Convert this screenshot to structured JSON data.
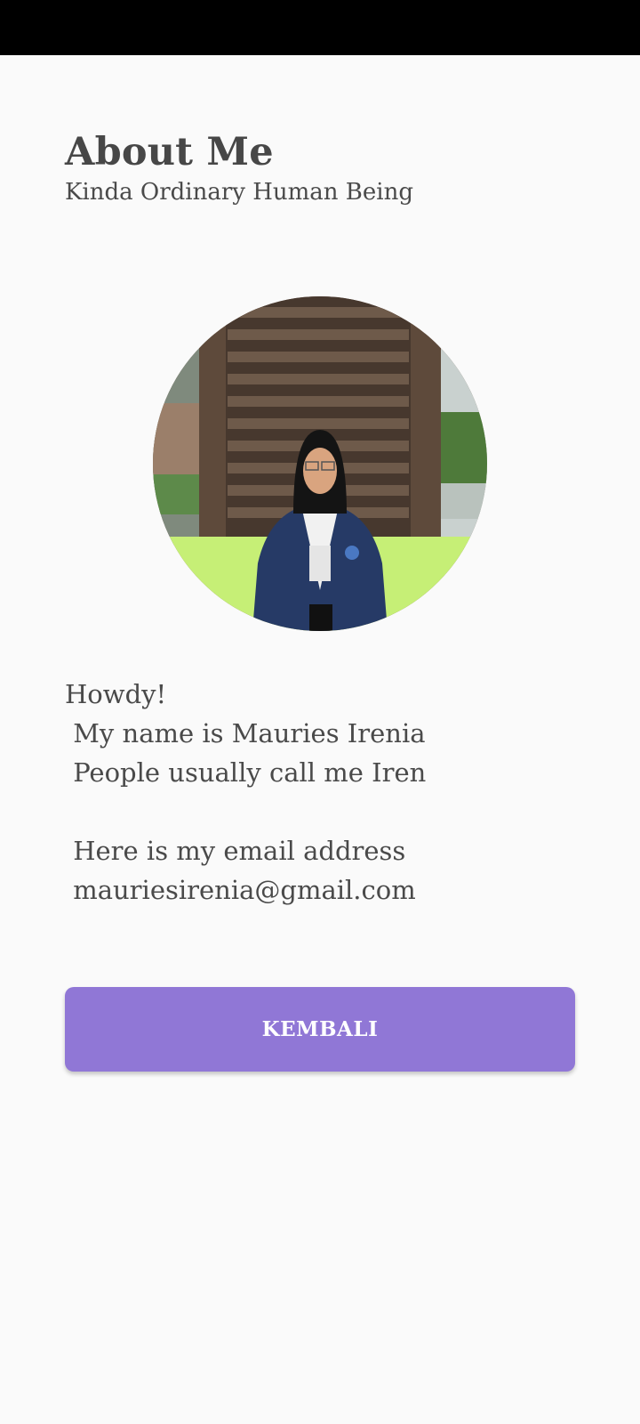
{
  "header": {
    "title": "About Me",
    "subtitle": "Kinda Ordinary Human Being"
  },
  "profile": {
    "photo_description": "profile-photo"
  },
  "bio": {
    "lines": [
      "Howdy!",
      " My name is Mauries Irenia",
      " People usually call me Iren",
      "",
      " Here is my email address",
      " mauriesirenia@gmail.com"
    ]
  },
  "actions": {
    "back_label": "KEMBALI"
  },
  "colors": {
    "background": "#fafafa",
    "status_bar": "#000000",
    "button": "#9077d6",
    "text": "#4a4a4a"
  }
}
